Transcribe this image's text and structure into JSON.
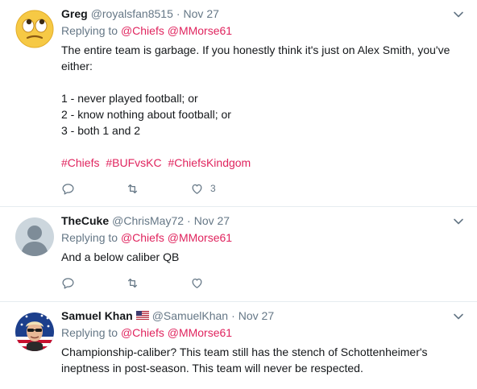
{
  "tweets": [
    {
      "name": "Greg",
      "handle": "@royalsfan8515",
      "dot": "·",
      "time": "Nov 27",
      "replying_label": "Replying to",
      "mentions": [
        "@Chiefs",
        "@MMorse61"
      ],
      "lines": [
        "The entire team is garbage. If you honestly think it's just on Alex Smith, you've",
        "either:",
        "",
        "1 - never played football; or",
        "2 - know nothing about football; or",
        "3 - both 1 and 2",
        ""
      ],
      "hashtags": [
        "#Chiefs",
        "#BUFvsKC",
        "#ChiefsKindgom"
      ],
      "like_count": "3"
    },
    {
      "name": "TheCuke",
      "handle": "@ChrisMay72",
      "dot": "·",
      "time": "Nov 27",
      "replying_label": "Replying to",
      "mentions": [
        "@Chiefs",
        "@MMorse61"
      ],
      "lines": [
        "And a below caliber QB"
      ],
      "like_count": ""
    },
    {
      "name": "Samuel Khan",
      "handle": "@SamuelKhan",
      "dot": "·",
      "time": "Nov 27",
      "replying_label": "Replying to",
      "mentions": [
        "@Chiefs",
        "@MMorse61"
      ],
      "lines": [
        "Championship-caliber? This team still has the stench of Schottenheimer's",
        "ineptness in post-season. This team will never be respected."
      ]
    }
  ],
  "colors": {
    "accent": "#e0245e",
    "secondary_text": "#657786",
    "divider": "#e6ecf0"
  },
  "icons": {
    "reply": "reply-icon",
    "retweet": "retweet-icon",
    "like": "heart-icon",
    "menu": "chevron-down-icon"
  }
}
